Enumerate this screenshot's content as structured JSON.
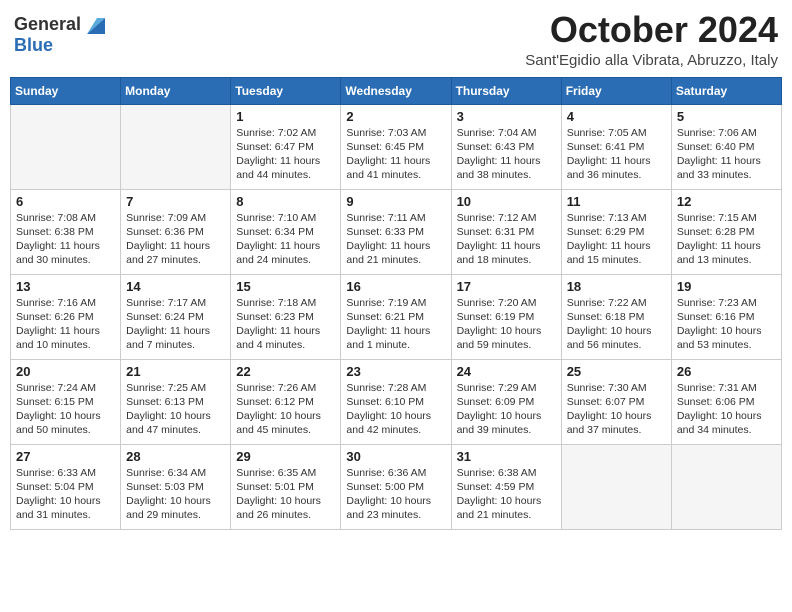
{
  "header": {
    "logo_line1": "General",
    "logo_line2": "Blue",
    "month": "October 2024",
    "location": "Sant'Egidio alla Vibrata, Abruzzo, Italy"
  },
  "weekdays": [
    "Sunday",
    "Monday",
    "Tuesday",
    "Wednesday",
    "Thursday",
    "Friday",
    "Saturday"
  ],
  "weeks": [
    [
      {
        "day": "",
        "info": ""
      },
      {
        "day": "",
        "info": ""
      },
      {
        "day": "1",
        "info": "Sunrise: 7:02 AM\nSunset: 6:47 PM\nDaylight: 11 hours\nand 44 minutes."
      },
      {
        "day": "2",
        "info": "Sunrise: 7:03 AM\nSunset: 6:45 PM\nDaylight: 11 hours\nand 41 minutes."
      },
      {
        "day": "3",
        "info": "Sunrise: 7:04 AM\nSunset: 6:43 PM\nDaylight: 11 hours\nand 38 minutes."
      },
      {
        "day": "4",
        "info": "Sunrise: 7:05 AM\nSunset: 6:41 PM\nDaylight: 11 hours\nand 36 minutes."
      },
      {
        "day": "5",
        "info": "Sunrise: 7:06 AM\nSunset: 6:40 PM\nDaylight: 11 hours\nand 33 minutes."
      }
    ],
    [
      {
        "day": "6",
        "info": "Sunrise: 7:08 AM\nSunset: 6:38 PM\nDaylight: 11 hours\nand 30 minutes."
      },
      {
        "day": "7",
        "info": "Sunrise: 7:09 AM\nSunset: 6:36 PM\nDaylight: 11 hours\nand 27 minutes."
      },
      {
        "day": "8",
        "info": "Sunrise: 7:10 AM\nSunset: 6:34 PM\nDaylight: 11 hours\nand 24 minutes."
      },
      {
        "day": "9",
        "info": "Sunrise: 7:11 AM\nSunset: 6:33 PM\nDaylight: 11 hours\nand 21 minutes."
      },
      {
        "day": "10",
        "info": "Sunrise: 7:12 AM\nSunset: 6:31 PM\nDaylight: 11 hours\nand 18 minutes."
      },
      {
        "day": "11",
        "info": "Sunrise: 7:13 AM\nSunset: 6:29 PM\nDaylight: 11 hours\nand 15 minutes."
      },
      {
        "day": "12",
        "info": "Sunrise: 7:15 AM\nSunset: 6:28 PM\nDaylight: 11 hours\nand 13 minutes."
      }
    ],
    [
      {
        "day": "13",
        "info": "Sunrise: 7:16 AM\nSunset: 6:26 PM\nDaylight: 11 hours\nand 10 minutes."
      },
      {
        "day": "14",
        "info": "Sunrise: 7:17 AM\nSunset: 6:24 PM\nDaylight: 11 hours\nand 7 minutes."
      },
      {
        "day": "15",
        "info": "Sunrise: 7:18 AM\nSunset: 6:23 PM\nDaylight: 11 hours\nand 4 minutes."
      },
      {
        "day": "16",
        "info": "Sunrise: 7:19 AM\nSunset: 6:21 PM\nDaylight: 11 hours\nand 1 minute."
      },
      {
        "day": "17",
        "info": "Sunrise: 7:20 AM\nSunset: 6:19 PM\nDaylight: 10 hours\nand 59 minutes."
      },
      {
        "day": "18",
        "info": "Sunrise: 7:22 AM\nSunset: 6:18 PM\nDaylight: 10 hours\nand 56 minutes."
      },
      {
        "day": "19",
        "info": "Sunrise: 7:23 AM\nSunset: 6:16 PM\nDaylight: 10 hours\nand 53 minutes."
      }
    ],
    [
      {
        "day": "20",
        "info": "Sunrise: 7:24 AM\nSunset: 6:15 PM\nDaylight: 10 hours\nand 50 minutes."
      },
      {
        "day": "21",
        "info": "Sunrise: 7:25 AM\nSunset: 6:13 PM\nDaylight: 10 hours\nand 47 minutes."
      },
      {
        "day": "22",
        "info": "Sunrise: 7:26 AM\nSunset: 6:12 PM\nDaylight: 10 hours\nand 45 minutes."
      },
      {
        "day": "23",
        "info": "Sunrise: 7:28 AM\nSunset: 6:10 PM\nDaylight: 10 hours\nand 42 minutes."
      },
      {
        "day": "24",
        "info": "Sunrise: 7:29 AM\nSunset: 6:09 PM\nDaylight: 10 hours\nand 39 minutes."
      },
      {
        "day": "25",
        "info": "Sunrise: 7:30 AM\nSunset: 6:07 PM\nDaylight: 10 hours\nand 37 minutes."
      },
      {
        "day": "26",
        "info": "Sunrise: 7:31 AM\nSunset: 6:06 PM\nDaylight: 10 hours\nand 34 minutes."
      }
    ],
    [
      {
        "day": "27",
        "info": "Sunrise: 6:33 AM\nSunset: 5:04 PM\nDaylight: 10 hours\nand 31 minutes."
      },
      {
        "day": "28",
        "info": "Sunrise: 6:34 AM\nSunset: 5:03 PM\nDaylight: 10 hours\nand 29 minutes."
      },
      {
        "day": "29",
        "info": "Sunrise: 6:35 AM\nSunset: 5:01 PM\nDaylight: 10 hours\nand 26 minutes."
      },
      {
        "day": "30",
        "info": "Sunrise: 6:36 AM\nSunset: 5:00 PM\nDaylight: 10 hours\nand 23 minutes."
      },
      {
        "day": "31",
        "info": "Sunrise: 6:38 AM\nSunset: 4:59 PM\nDaylight: 10 hours\nand 21 minutes."
      },
      {
        "day": "",
        "info": ""
      },
      {
        "day": "",
        "info": ""
      }
    ]
  ]
}
